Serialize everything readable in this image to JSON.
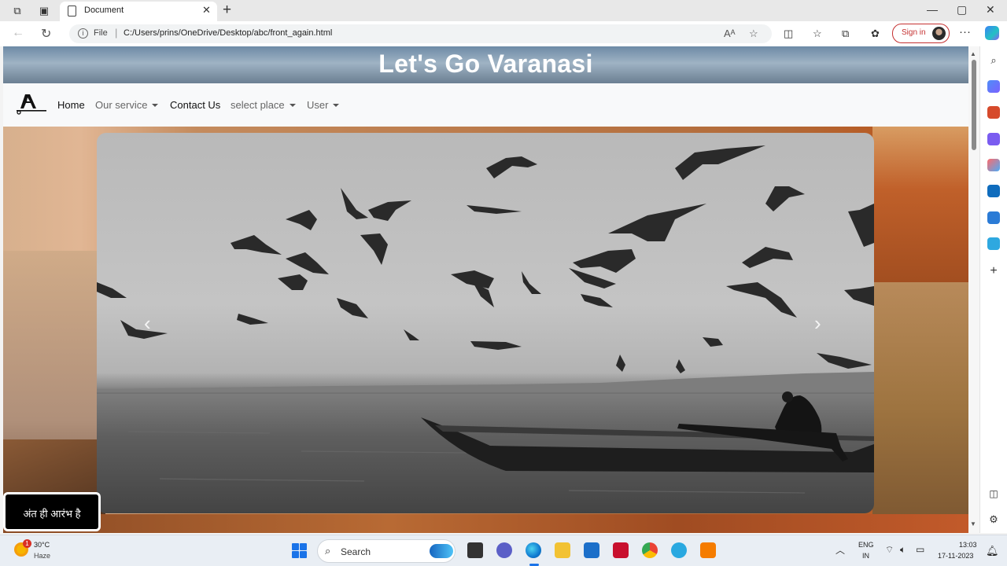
{
  "browser": {
    "tab_title": "Document",
    "url_scheme": "File",
    "url": "C:/Users/prins/OneDrive/Desktop/abc/front_again.html",
    "sign_in_label": "Sign in"
  },
  "page": {
    "hero_title": "Let's Go Varanasi",
    "nav": {
      "home": "Home",
      "our_service": "Our service",
      "contact_us": "Contact Us",
      "select_place": "select place",
      "user": "User"
    },
    "carousel": {
      "prev_glyph": "‹",
      "next_glyph": "›"
    },
    "quote": "अंत ही आरंभ है"
  },
  "taskbar": {
    "weather_badge": "1",
    "weather_temp": "30°C",
    "weather_desc": "Haze",
    "search_label": "Search",
    "lang_line1": "ENG",
    "lang_line2": "IN",
    "time": "13:03",
    "date": "17-11-2023"
  },
  "colors": {
    "accent": "#1a73e8",
    "sign_in": "#c53030",
    "navbar_bg": "#f8f9fa"
  }
}
